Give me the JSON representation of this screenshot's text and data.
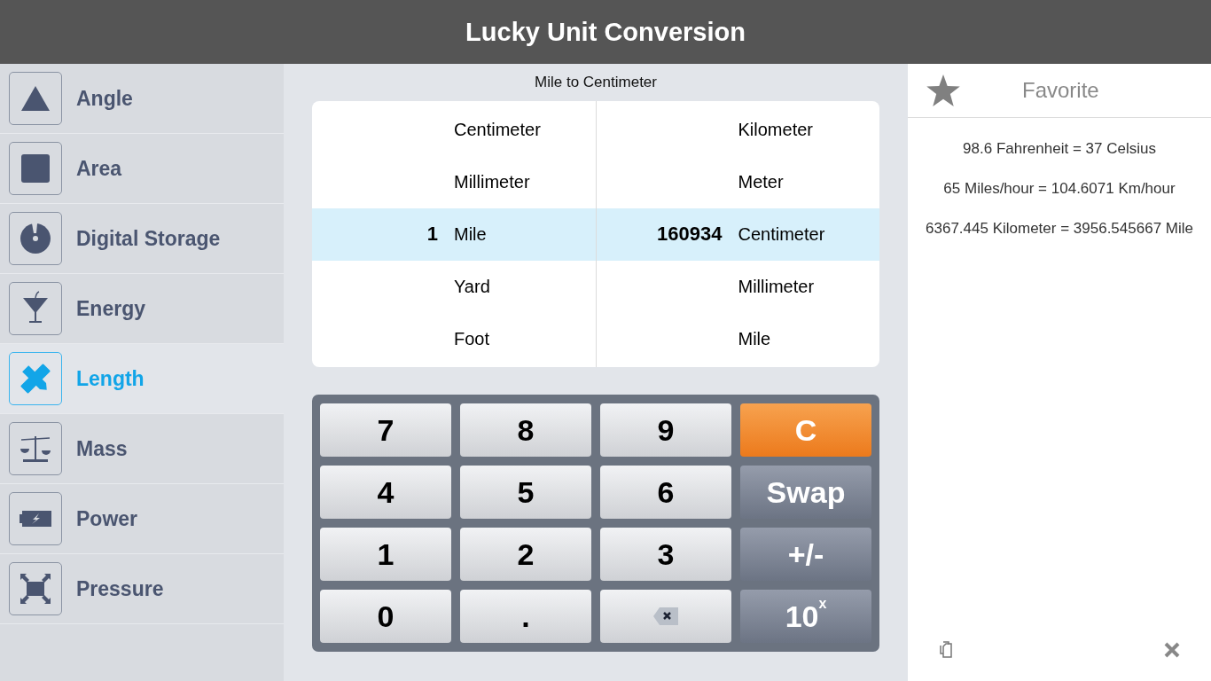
{
  "header": {
    "title": "Lucky Unit Conversion"
  },
  "sidebar": {
    "items": [
      {
        "label": "Angle",
        "selected": false
      },
      {
        "label": "Area",
        "selected": false
      },
      {
        "label": "Digital Storage",
        "selected": false
      },
      {
        "label": "Energy",
        "selected": false
      },
      {
        "label": "Length",
        "selected": true
      },
      {
        "label": "Mass",
        "selected": false
      },
      {
        "label": "Power",
        "selected": false
      },
      {
        "label": "Pressure",
        "selected": false
      }
    ]
  },
  "converter": {
    "title": "Mile to Centimeter",
    "from_units": [
      {
        "unit": "Centimeter",
        "selected": false
      },
      {
        "unit": "Millimeter",
        "selected": false
      },
      {
        "unit": "Mile",
        "selected": true,
        "value": "1"
      },
      {
        "unit": "Yard",
        "selected": false
      },
      {
        "unit": "Foot",
        "selected": false
      }
    ],
    "to_units": [
      {
        "unit": "Kilometer",
        "selected": false
      },
      {
        "unit": "Meter",
        "selected": false
      },
      {
        "unit": "Centimeter",
        "selected": true,
        "value": "160934"
      },
      {
        "unit": "Millimeter",
        "selected": false
      },
      {
        "unit": "Mile",
        "selected": false
      }
    ]
  },
  "keypad": {
    "keys": [
      {
        "label": "7",
        "kind": "digit"
      },
      {
        "label": "8",
        "kind": "digit"
      },
      {
        "label": "9",
        "kind": "digit"
      },
      {
        "label": "C",
        "kind": "clear"
      },
      {
        "label": "4",
        "kind": "digit"
      },
      {
        "label": "5",
        "kind": "digit"
      },
      {
        "label": "6",
        "kind": "digit"
      },
      {
        "label": "Swap",
        "kind": "op"
      },
      {
        "label": "1",
        "kind": "digit"
      },
      {
        "label": "2",
        "kind": "digit"
      },
      {
        "label": "3",
        "kind": "digit"
      },
      {
        "label": "+/-",
        "kind": "op"
      },
      {
        "label": "0",
        "kind": "digit"
      },
      {
        "label": ".",
        "kind": "digit"
      },
      {
        "kind": "backspace"
      },
      {
        "label": "10$^{x}$",
        "kind": "op"
      }
    ]
  },
  "favorites": {
    "title": "Favorite",
    "entries": [
      "98.6 Fahrenheit = 37 Celsius",
      "65 Miles/hour = 104.6071 Km/hour",
      "6367.445 Kilometer = 3956.545667 Mile"
    ]
  }
}
